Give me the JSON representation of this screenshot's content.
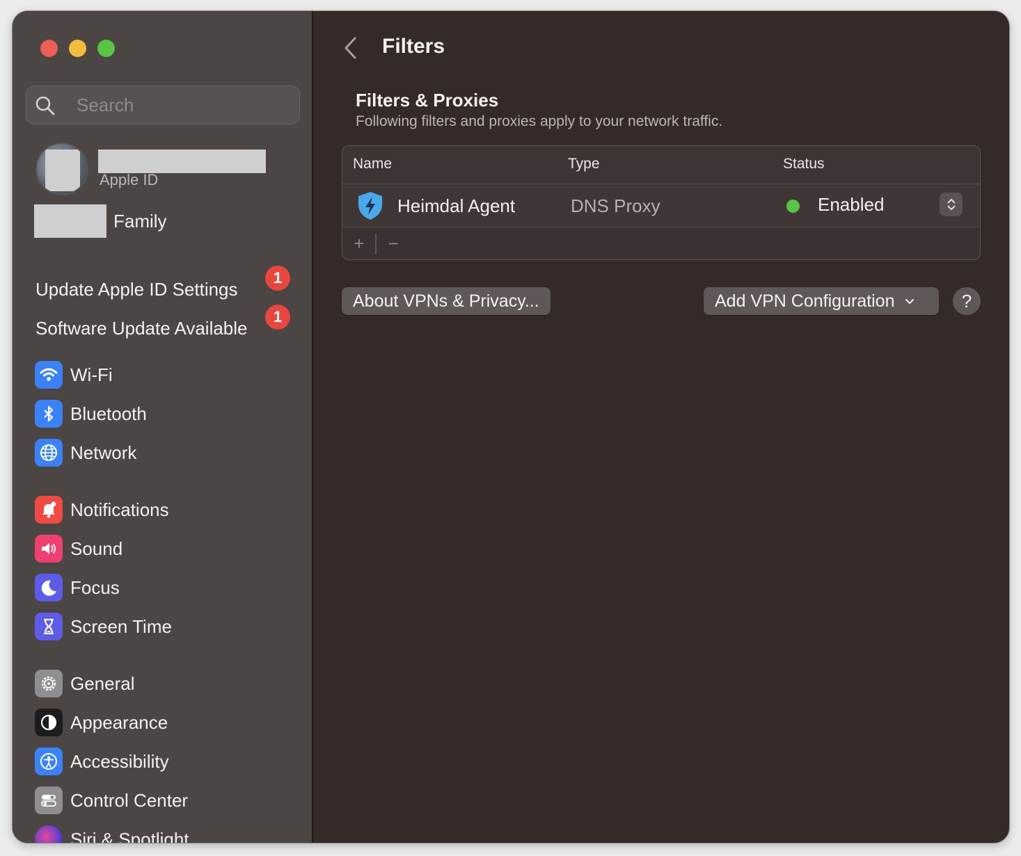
{
  "sidebar": {
    "search_placeholder": "Search",
    "account": {
      "subtitle": "Apple ID",
      "family_label": "Family"
    },
    "notices": [
      {
        "label": "Update Apple ID Settings",
        "badge": "1"
      },
      {
        "label": "Software Update Available",
        "badge": "1"
      }
    ],
    "items": [
      {
        "label": "Wi-Fi",
        "icon": "wifi-icon",
        "color": "#3b82f6"
      },
      {
        "label": "Bluetooth",
        "icon": "bluetooth-icon",
        "color": "#3b82f6"
      },
      {
        "label": "Network",
        "icon": "globe-icon",
        "color": "#3b82f6"
      },
      {
        "label": "Notifications",
        "icon": "bell-icon",
        "color": "#ef4a43"
      },
      {
        "label": "Sound",
        "icon": "speaker-icon",
        "color": "#ef4070"
      },
      {
        "label": "Focus",
        "icon": "moon-icon",
        "color": "#5e5ce6"
      },
      {
        "label": "Screen Time",
        "icon": "hourglass-icon",
        "color": "#5e5ce6"
      },
      {
        "label": "General",
        "icon": "gear-icon",
        "color": "#8e8e93"
      },
      {
        "label": "Appearance",
        "icon": "appearance-icon",
        "color": "#1c1c1e"
      },
      {
        "label": "Accessibility",
        "icon": "accessibility-icon",
        "color": "#3b82f6"
      },
      {
        "label": "Control Center",
        "icon": "toggles-icon",
        "color": "#8e8e93"
      },
      {
        "label": "Siri & Spotlight",
        "icon": "siri-icon",
        "color": "#7a3ccf"
      }
    ]
  },
  "main": {
    "title": "Filters",
    "section_title": "Filters & Proxies",
    "section_subtitle": "Following filters and proxies apply to your network traffic.",
    "table": {
      "columns": [
        "Name",
        "Type",
        "Status"
      ],
      "rows": [
        {
          "name": "Heimdal Agent",
          "type": "DNS Proxy",
          "status": "Enabled",
          "status_color": "#5cc445"
        }
      ],
      "add_label": "+",
      "remove_label": "−"
    },
    "about_button": "About VPNs & Privacy...",
    "add_vpn_button": "Add VPN Configuration",
    "help_label": "?"
  }
}
